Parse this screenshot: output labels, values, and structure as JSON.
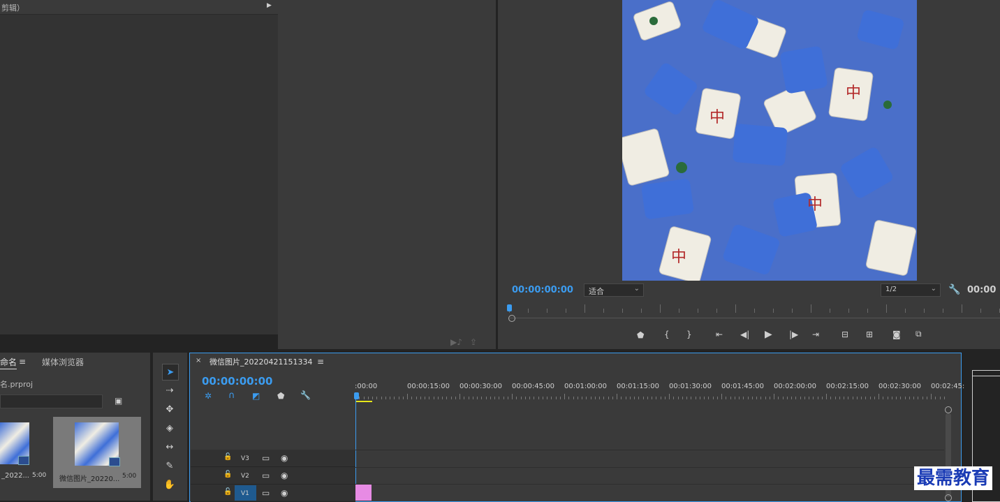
{
  "source_panel": {
    "title": "剪辑）"
  },
  "program_monitor": {
    "timecode": "00:00:00:00",
    "zoom": "适合",
    "resolution": "1/2",
    "timecode_right": "00:00"
  },
  "project_panel": {
    "tab_project": "命名",
    "tab_media_browser": "媒体浏览器",
    "file_name": "名.prproj",
    "items": [
      {
        "name": "_2022...",
        "duration": "5:00"
      },
      {
        "name": "微信图片_20220...",
        "duration": "5:00"
      }
    ]
  },
  "timeline": {
    "sequence_name": "微信图片_20220421151334",
    "timecode": "00:00:00:00",
    "ruler": [
      ":00:00",
      "00:00:15:00",
      "00:00:30:00",
      "00:00:45:00",
      "00:01:00:00",
      "00:01:15:00",
      "00:01:30:00",
      "00:01:45:00",
      "00:02:00:00",
      "00:02:15:00",
      "00:02:30:00",
      "00:02:45:"
    ],
    "tracks": [
      {
        "name": "V3"
      },
      {
        "name": "V2"
      },
      {
        "name": "V1"
      }
    ]
  },
  "watermark": "最需教育",
  "colors": {
    "accent": "#3b9cf0",
    "clip": "#e78be4",
    "panel": "#3c3c3c"
  }
}
